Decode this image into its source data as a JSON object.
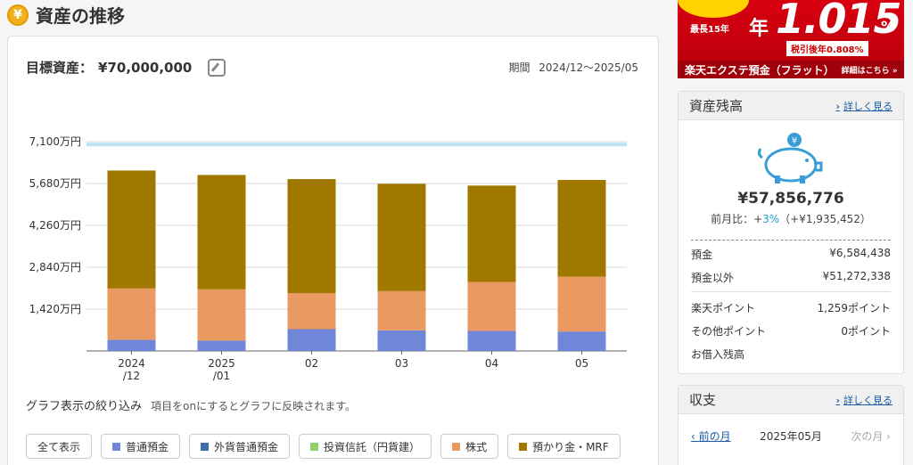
{
  "header": {
    "title": "資産の推移",
    "icon": "yen-coin-icon"
  },
  "goal": {
    "label": "目標資産：",
    "value": "¥70,000,000"
  },
  "period": {
    "label": "期間",
    "value": "2024/12〜2025/05"
  },
  "chart_data": {
    "type": "bar",
    "stacked": true,
    "categories": [
      "2024/12",
      "2025/01",
      "02",
      "03",
      "04",
      "05"
    ],
    "category_lines": [
      [
        "2024",
        "/12"
      ],
      [
        "2025",
        "/01"
      ],
      [
        "02"
      ],
      [
        "03"
      ],
      [
        "04"
      ],
      [
        "05"
      ]
    ],
    "series": [
      {
        "name": "普通預金",
        "color": "#6f86d9",
        "values": [
          380,
          350,
          740,
          700,
          680,
          660
        ]
      },
      {
        "name": "外貨普通預金",
        "color": "#3f6fa8",
        "values": [
          0,
          0,
          0,
          0,
          0,
          0
        ]
      },
      {
        "name": "投資信託（円貨建）",
        "color": "#8fd16b",
        "values": [
          0,
          0,
          0,
          0,
          0,
          0
        ]
      },
      {
        "name": "株式",
        "color": "#ea9a60",
        "values": [
          1740,
          1740,
          1220,
          1330,
          1660,
          1860
        ]
      },
      {
        "name": "預かり金・MRF",
        "color": "#a07800",
        "values": [
          4000,
          3880,
          3870,
          3640,
          3270,
          3280
        ]
      }
    ],
    "goal_line": 7000,
    "yticks": [
      "1,420万円",
      "2,840万円",
      "4,260万円",
      "5,680万円",
      "7,100万円"
    ],
    "ytick_values": [
      1420,
      2840,
      4260,
      5680,
      7100
    ],
    "ylim": [
      0,
      7100
    ],
    "grid": true
  },
  "filter": {
    "title": "グラフ表示の絞り込み",
    "hint": "項目をonにするとグラフに反映されます。",
    "all_label": "全て表示",
    "items": [
      {
        "label": "普通預金",
        "color": "#6f86d9"
      },
      {
        "label": "外貨普通預金",
        "color": "#3f6fa8"
      },
      {
        "label": "投資信託（円貨建）",
        "color": "#8fd16b"
      },
      {
        "label": "株式",
        "color": "#ea9a60"
      },
      {
        "label": "預かり金・MRF",
        "color": "#a07800"
      }
    ]
  },
  "ad": {
    "span": "最長15年",
    "year": "年",
    "rate": "1.015",
    "pct": "%",
    "after_tax": "税引後年0.808%",
    "product": "楽天エクステ預金（フラット）",
    "more": "詳細はこちら »"
  },
  "balance": {
    "title": "資産残高",
    "detail_link": "詳しく見る",
    "total": "¥57,856,776",
    "mom_label": "前月比：+",
    "mom_pct": "3%",
    "mom_amount": "（+¥1,935,452）",
    "deposit_label": "預金",
    "deposit_value": "¥6,584,438",
    "other_label": "預金以外",
    "other_value": "¥51,272,338",
    "rakuten_points_label": "楽天ポイント",
    "rakuten_points_value": "1,259ポイント",
    "other_points_label": "その他ポイント",
    "other_points_value": "0ポイント",
    "loan_label": "お借入残高"
  },
  "income": {
    "title": "収支",
    "detail_link": "詳しく見る",
    "prev": "前の月",
    "month": "2025年05月",
    "next": "次の月 ›"
  }
}
